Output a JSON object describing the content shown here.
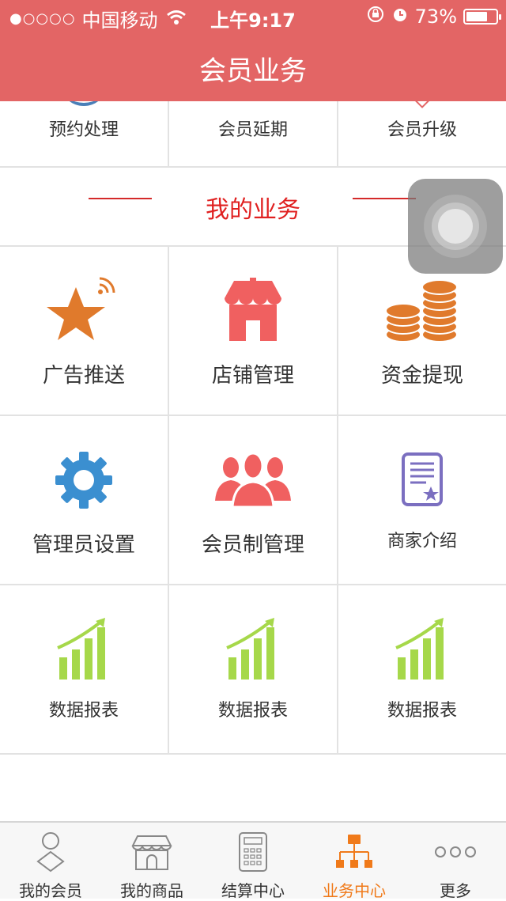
{
  "status_bar": {
    "signal_dots": "●○○○○",
    "carrier": "中国移动",
    "time": "上午9:17",
    "battery_percent": "73%",
    "battery_level": 0.73
  },
  "nav": {
    "title": "会员业务"
  },
  "top_items": [
    {
      "label": "预约处理"
    },
    {
      "label": "会员延期"
    },
    {
      "label": "会员升级"
    }
  ],
  "section": {
    "title": "我的业务"
  },
  "grid": [
    {
      "label": "广告推送",
      "icon": "star-signal-icon"
    },
    {
      "label": "店铺管理",
      "icon": "shop-icon"
    },
    {
      "label": "资金提现",
      "icon": "coins-icon"
    },
    {
      "label": "管理员设置",
      "icon": "gear-icon"
    },
    {
      "label": "会员制管理",
      "icon": "users-icon"
    },
    {
      "label": "商家介绍",
      "icon": "certificate-icon"
    },
    {
      "label": "数据报表",
      "icon": "bar-chart-icon"
    },
    {
      "label": "数据报表",
      "icon": "bar-chart-icon"
    },
    {
      "label": "数据报表",
      "icon": "bar-chart-icon"
    }
  ],
  "tabs": [
    {
      "label": "我的会员",
      "icon": "member-icon"
    },
    {
      "label": "我的商品",
      "icon": "store-icon"
    },
    {
      "label": "结算中心",
      "icon": "calculator-icon"
    },
    {
      "label": "业务中心",
      "icon": "org-chart-icon",
      "active": true
    },
    {
      "label": "更多",
      "icon": "more-icon"
    }
  ],
  "colors": {
    "header": "#e36565",
    "section_title": "#e02020",
    "orange": "#e07a2c",
    "red_icon": "#f06060",
    "blue_icon": "#3b8fd0",
    "purple_icon": "#7b6fc0",
    "green_icon": "#a6d84a",
    "tab_active": "#f07a1a"
  }
}
